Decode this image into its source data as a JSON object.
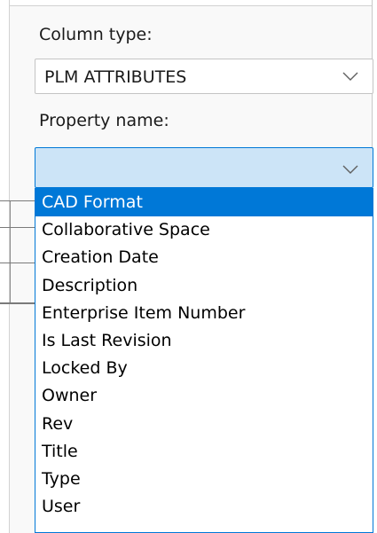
{
  "column_type": {
    "label": "Column type:",
    "selected_value": "PLM ATTRIBUTES",
    "icon": "chevron-down-icon"
  },
  "property_name": {
    "label": "Property name:",
    "selected_value": "",
    "icon": "chevron-down-icon",
    "highlighted_option_index": 0,
    "options": [
      "CAD Format",
      "Collaborative Space",
      "Creation Date",
      "Description",
      "Enterprise Item Number",
      "Is Last Revision",
      "Locked By",
      "Owner",
      "Rev",
      "Title",
      "Type",
      "User"
    ]
  },
  "colors": {
    "focus_border": "#0078d7",
    "highlight": "#0078d7",
    "highlight_text": "#ffffff",
    "open_select_fill": "#cce4f7"
  }
}
